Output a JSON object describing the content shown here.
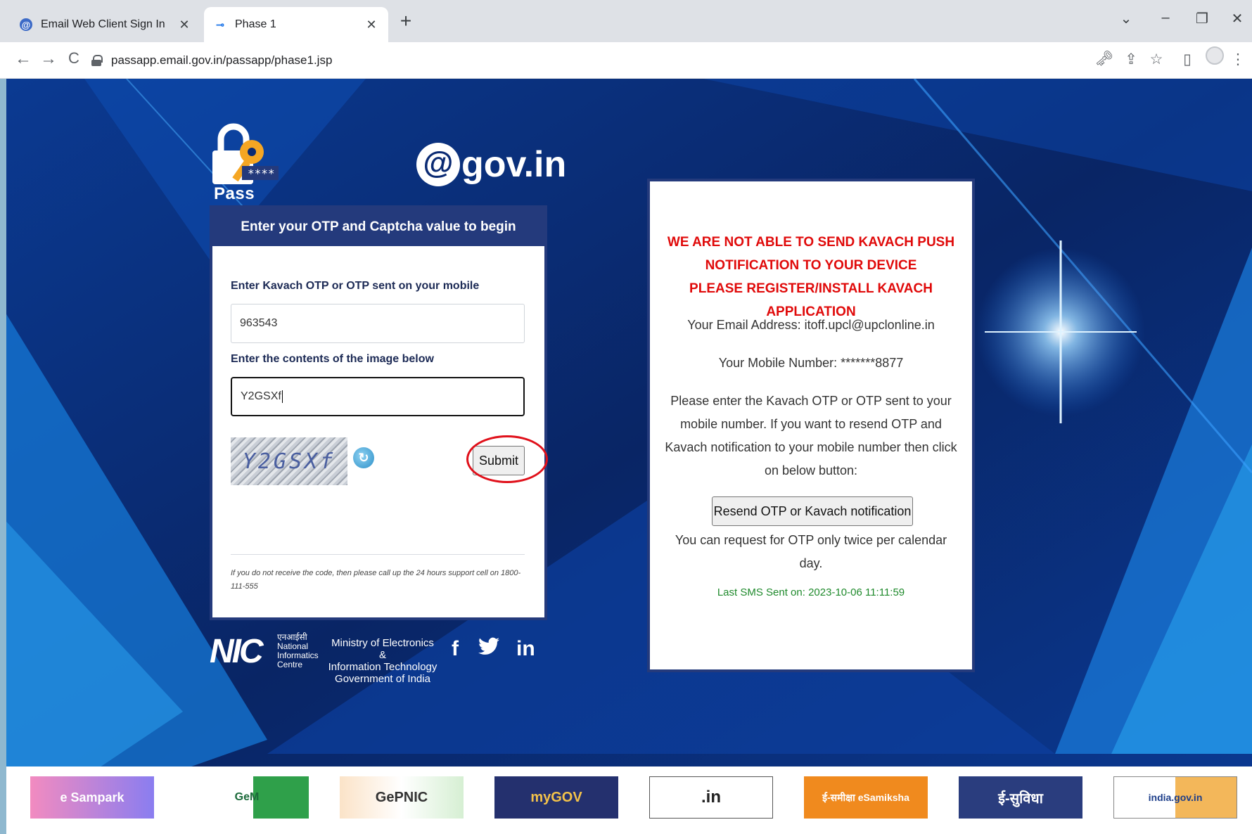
{
  "browser": {
    "tabs": [
      {
        "title": "Email Web Client Sign In",
        "favicon": "at-icon",
        "active": false
      },
      {
        "title": "Phase 1",
        "favicon": "key-icon",
        "active": true
      }
    ],
    "new_tab": "+",
    "url": "passapp.email.gov.in/passapp/phase1.jsp",
    "window_controls": {
      "dropdown": "⌄",
      "minimize": "–",
      "restore": "❐",
      "close": "✕"
    },
    "nav": {
      "back": "←",
      "forward": "→",
      "reload": "C"
    },
    "toolbar_icons": {
      "key": "🗝",
      "share": "⇪",
      "star": "☆",
      "sidepanel": "▯",
      "menu": "⋮"
    }
  },
  "branding": {
    "pass_app": "Pass App",
    "gov_at": "@",
    "gov_text": "gov.in"
  },
  "login_card": {
    "header": "Enter your OTP and Captcha value to begin",
    "otp_label": "Enter Kavach OTP or OTP sent on your mobile",
    "otp_value": "963543",
    "captcha_label": "Enter the contents of the image below",
    "captcha_value": "Y2GSXf",
    "captcha_image_text": "Y2GSXf",
    "submit_label": "Submit",
    "support_text": "If you do not receive the code, then please call up the 24 hours support cell on 1800-111-555"
  },
  "footer": {
    "nic_mark": "NIC",
    "nic_hindi": "एनआईसी",
    "nic_name": [
      "National",
      "Informatics",
      "Centre"
    ],
    "ministry": [
      "Ministry of Electronics &",
      "Information Technology",
      "Government of India"
    ],
    "social": {
      "facebook": "f",
      "twitter": "🐦",
      "linkedin": "in"
    }
  },
  "notice_card": {
    "warning_lines": [
      "WE ARE NOT ABLE TO SEND KAVACH PUSH",
      "NOTIFICATION TO YOUR DEVICE",
      "PLEASE REGISTER/INSTALL KAVACH APPLICATION"
    ],
    "email_line": "Your Email Address: itoff.upcl@upclonline.in",
    "mobile_line": "Your Mobile Number: *******8877",
    "instructions": "Please enter the Kavach OTP or OTP sent to your mobile number. If you want to resend OTP and Kavach notification to your mobile number then click on below button:",
    "resend_label": "Resend OTP or Kavach notification",
    "limit_text": "You can request for OTP only twice per calendar day.",
    "last_sms": "Last SMS Sent on: 2023-10-06 11:11:59"
  },
  "banners": [
    {
      "name": "esampark-banner",
      "text": "e Sampark"
    },
    {
      "name": "gem-banner",
      "text": "GeM"
    },
    {
      "name": "gepnic-banner",
      "text": "GePNIC"
    },
    {
      "name": "mygov-banner",
      "text": "myGOV"
    },
    {
      "name": "in-registry-banner",
      "text": ".in"
    },
    {
      "name": "esamiksha-banner",
      "text": "ई-समीक्षा eSamiksha"
    },
    {
      "name": "esuvidha-banner",
      "text": "ई-सुविधा"
    },
    {
      "name": "indiagov-banner",
      "text": "india.gov.in"
    }
  ],
  "colors": {
    "page_bg": "#0a2a73",
    "card_header": "#243a7c",
    "warning": "#e00a0a",
    "last_sms": "#1f8a2c",
    "highlight_ring": "#e0101a"
  }
}
